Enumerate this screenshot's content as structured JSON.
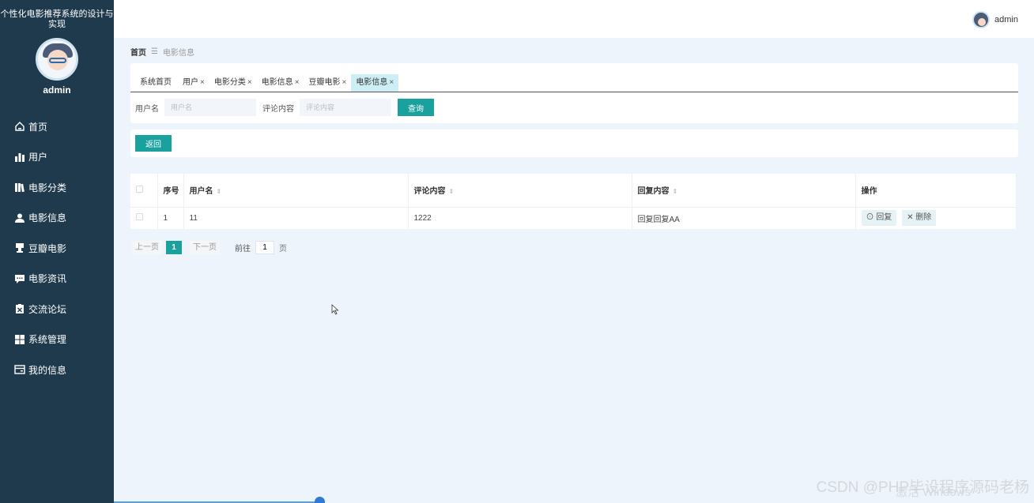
{
  "sidebar": {
    "title": "个性化电影推荐系统的设计与实现",
    "username": "admin",
    "items": [
      {
        "label": "首页",
        "icon": "home-icon"
      },
      {
        "label": "用户",
        "icon": "bar-chart-icon"
      },
      {
        "label": "电影分类",
        "icon": "books-icon"
      },
      {
        "label": "电影信息",
        "icon": "user-icon"
      },
      {
        "label": "豆瓣电影",
        "icon": "stamp-icon"
      },
      {
        "label": "电影资讯",
        "icon": "chat-icon"
      },
      {
        "label": "交流论坛",
        "icon": "clipboard-icon"
      },
      {
        "label": "系统管理",
        "icon": "grid-icon"
      },
      {
        "label": "我的信息",
        "icon": "card-icon"
      }
    ]
  },
  "header": {
    "username": "admin"
  },
  "breadcrumb": {
    "home": "首页",
    "separator": "☰",
    "current": "电影信息"
  },
  "tabs": [
    {
      "label": "系统首页",
      "close": ""
    },
    {
      "label": "用户",
      "close": "×"
    },
    {
      "label": "电影分类",
      "close": "×"
    },
    {
      "label": "电影信息",
      "close": "×"
    },
    {
      "label": "豆瓣电影",
      "close": "×"
    },
    {
      "label": "电影信息",
      "close": "×"
    }
  ],
  "search": {
    "username_label": "用户名",
    "username_placeholder": "用户名",
    "content_label": "评论内容",
    "content_placeholder": "评论内容",
    "query_button": "查询"
  },
  "actions": {
    "back_button": "返回"
  },
  "table": {
    "headers": {
      "index": "序号",
      "username": "用户名",
      "content": "评论内容",
      "reply": "回复内容",
      "operation": "操作"
    },
    "rows": [
      {
        "index": "1",
        "username": "11",
        "content": "1222",
        "reply": "回复回复AA",
        "reply_btn": "回复",
        "delete_btn": "删除"
      }
    ]
  },
  "pagination": {
    "prev": "上一页",
    "current": "1",
    "next": "下一页",
    "goto_label": "前往",
    "goto_value": "1",
    "page_suffix": "页"
  },
  "watermark": {
    "text": "CSDN @PHP毕设程序源码老杨",
    "text2": "激活 Windows"
  },
  "colors": {
    "sidebar_bg": "#1f3a4d",
    "accent": "#1aa19d",
    "active_tab": "#cdeef5"
  }
}
